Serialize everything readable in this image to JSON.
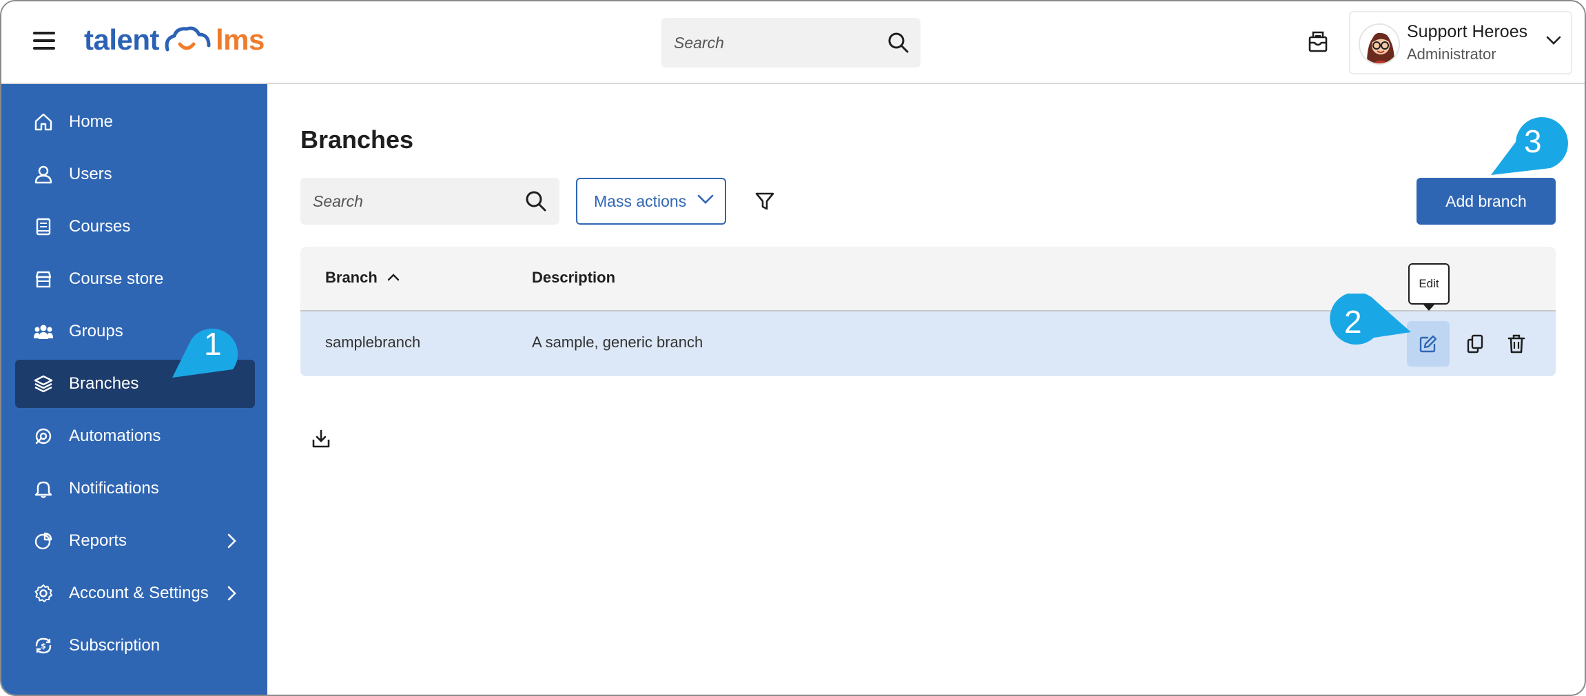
{
  "header": {
    "logo_part1": "talent",
    "logo_part2": "lms",
    "search_placeholder": "Search",
    "user": {
      "name": "Support Heroes",
      "role": "Administrator"
    }
  },
  "sidebar": {
    "items": [
      {
        "label": "Home",
        "icon": "home-icon"
      },
      {
        "label": "Users",
        "icon": "user-icon"
      },
      {
        "label": "Courses",
        "icon": "book-icon"
      },
      {
        "label": "Course store",
        "icon": "store-icon"
      },
      {
        "label": "Groups",
        "icon": "groups-icon"
      },
      {
        "label": "Branches",
        "icon": "layers-icon",
        "active": true
      },
      {
        "label": "Automations",
        "icon": "automation-icon"
      },
      {
        "label": "Notifications",
        "icon": "bell-icon"
      },
      {
        "label": "Reports",
        "icon": "pie-chart-icon",
        "has_submenu": true
      },
      {
        "label": "Account & Settings",
        "icon": "gear-icon",
        "has_submenu": true
      },
      {
        "label": "Subscription",
        "icon": "subscription-icon"
      }
    ]
  },
  "main": {
    "title": "Branches",
    "search_placeholder": "Search",
    "mass_actions_label": "Mass actions",
    "add_branch_label": "Add branch",
    "table": {
      "columns": [
        "Branch",
        "Description"
      ],
      "rows": [
        {
          "branch": "samplebranch",
          "description": "A sample, generic branch"
        }
      ]
    },
    "tooltip": "Edit"
  },
  "callouts": [
    "1",
    "2",
    "3"
  ],
  "colors": {
    "brand_blue": "#2f66b4",
    "sidebar_active": "#1c3c6c",
    "brand_orange": "#f07c2b",
    "callout_blue": "#1aa7e6",
    "row_highlight": "#dce8f7"
  }
}
